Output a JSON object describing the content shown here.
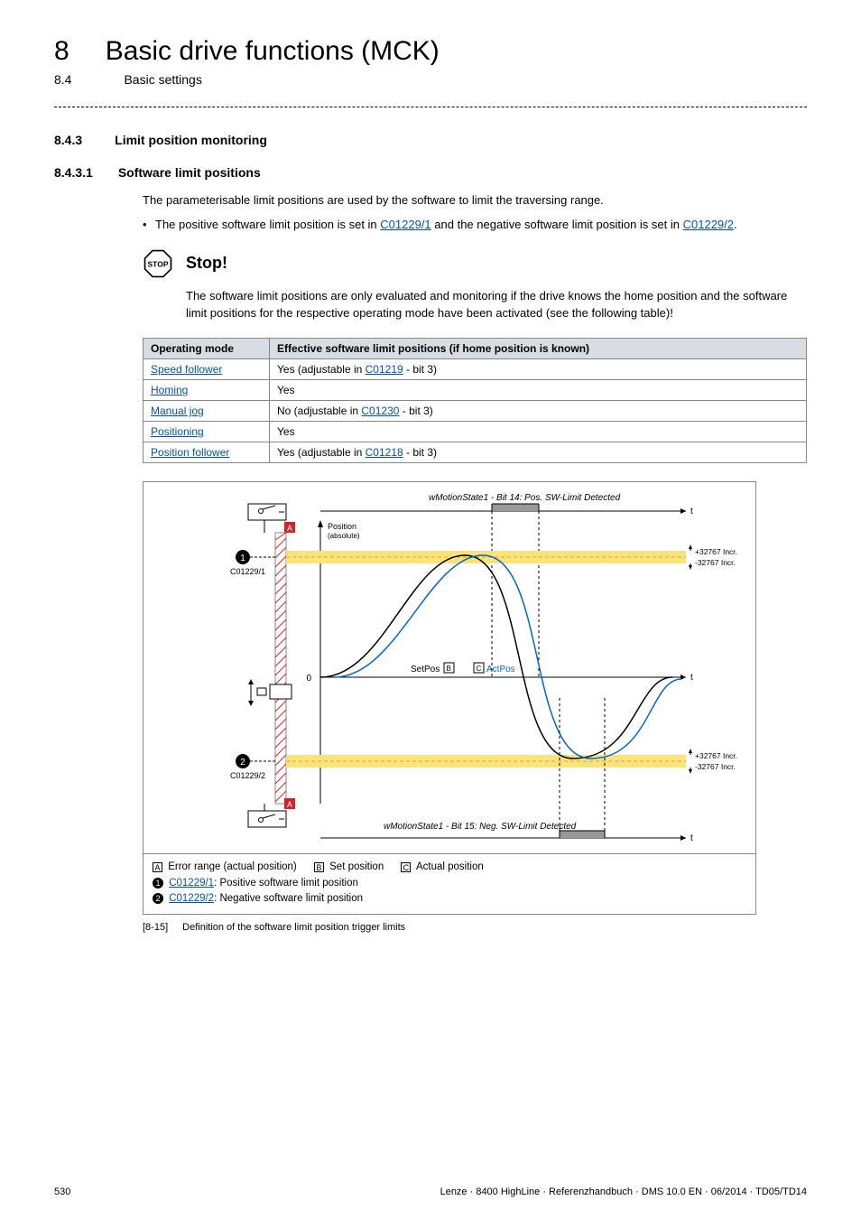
{
  "chapter": {
    "num": "8",
    "title": "Basic drive functions (MCK)"
  },
  "section": {
    "num": "8.4",
    "title": "Basic settings"
  },
  "h3": {
    "num": "8.4.3",
    "title": "Limit position monitoring"
  },
  "h4": {
    "num": "8.4.3.1",
    "title": "Software limit positions"
  },
  "intro": "The parameterisable limit positions are used by the software to limit the traversing range.",
  "bullet_pre": "The positive software limit position is set in ",
  "bullet_link1": "C01229/1",
  "bullet_mid": " and the negative software limit position is set in ",
  "bullet_link2": "C01229/2",
  "bullet_post": ".",
  "stop": {
    "icon_text": "STOP",
    "label": "Stop!",
    "body": "The software limit positions are only evaluated and monitoring if the drive knows the home position and the software limit positions for the respective operating mode have been activated (see the following table)!"
  },
  "table": {
    "head": {
      "c1": "Operating mode",
      "c2": "Effective software limit positions (if home position is known)"
    },
    "rows": [
      {
        "mode": "Speed follower",
        "eff_pre": "Yes (adjustable in ",
        "eff_link": "C01219",
        "eff_post": "  - bit 3)"
      },
      {
        "mode": "Homing",
        "eff_pre": "Yes",
        "eff_link": "",
        "eff_post": ""
      },
      {
        "mode": "Manual jog",
        "eff_pre": "No (adjustable in ",
        "eff_link": "C01230",
        "eff_post": " - bit 3)"
      },
      {
        "mode": "Positioning",
        "eff_pre": "Yes",
        "eff_link": "",
        "eff_post": ""
      },
      {
        "mode": "Position follower",
        "eff_pre": "Yes (adjustable in ",
        "eff_link": "C01218",
        "eff_post": "  - bit 3)"
      }
    ]
  },
  "diagram": {
    "top_bit": "wMotionState1 - Bit 14: Pos. SW-Limit Detected",
    "bot_bit": "wMotionState1 - Bit 15: Neg. SW-Limit Detected",
    "pos_label1": "Position",
    "pos_label2": "(absolute)",
    "plus_incr": "+32767 Incr.",
    "minus_incr": "-32767 Incr.",
    "c1": "C01229/1",
    "c2": "C01229/2",
    "zero": "0",
    "setpos": "SetPos",
    "actpos": "ActPos",
    "t": "t",
    "markA": "A",
    "markB": "B",
    "markC": "C",
    "circ1": "1",
    "circ2": "2"
  },
  "legend": {
    "a": "Error range (actual position)",
    "b": "Set position",
    "c": "Actual position",
    "l1_link": "C01229/1",
    "l1_txt": ": Positive software limit position",
    "l2_link": "C01229/2",
    "l2_txt": ": Negative software limit position"
  },
  "figcap": {
    "num": "[8-15]",
    "txt": "Definition of the software limit position trigger limits"
  },
  "footer": {
    "page": "530",
    "doc": "Lenze · 8400 HighLine · Referenzhandbuch · DMS 10.0 EN · 06/2014 · TD05/TD14"
  }
}
